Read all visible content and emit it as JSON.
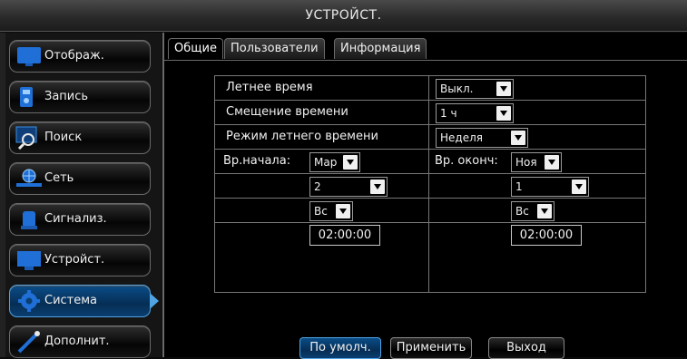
{
  "window": {
    "title": "УСТРОЙСТ."
  },
  "sidebar": {
    "items": [
      {
        "label": "Отображ.",
        "icon": "monitor-icon"
      },
      {
        "label": "Запись",
        "icon": "record-icon"
      },
      {
        "label": "Поиск",
        "icon": "search-icon"
      },
      {
        "label": "Сеть",
        "icon": "network-icon"
      },
      {
        "label": "Сигнализ.",
        "icon": "alarm-icon"
      },
      {
        "label": "Устройст.",
        "icon": "device-icon"
      },
      {
        "label": "Система",
        "icon": "gear-icon",
        "active": true
      },
      {
        "label": "Дополнит.",
        "icon": "tools-icon"
      }
    ]
  },
  "tabs": [
    {
      "label": "Общие",
      "active": true
    },
    {
      "label": "Пользователи"
    },
    {
      "label": "Информация"
    }
  ],
  "settings": {
    "dst_label": "Летнее время",
    "dst_value": "Выкл.",
    "offset_label": "Смещение времени",
    "offset_value": "1 ч",
    "mode_label": "Режим летнего времени",
    "mode_value": "Неделя",
    "start_label": "Вр.начала:",
    "start_month": "Мар",
    "end_label": "Вр. оконч:",
    "end_month": "Ноя",
    "start_week": "2",
    "end_week": "1",
    "start_day": "Вс",
    "end_day": "Вс",
    "start_time": "02:00:00",
    "end_time": "02:00:00"
  },
  "buttons": {
    "default": "По умолч.",
    "apply": "Применить",
    "exit": "Выход"
  },
  "colors": {
    "accent": "#4fa3e3",
    "active_bg": "#0a4d88",
    "icon_blue": "#1f6fd6"
  }
}
